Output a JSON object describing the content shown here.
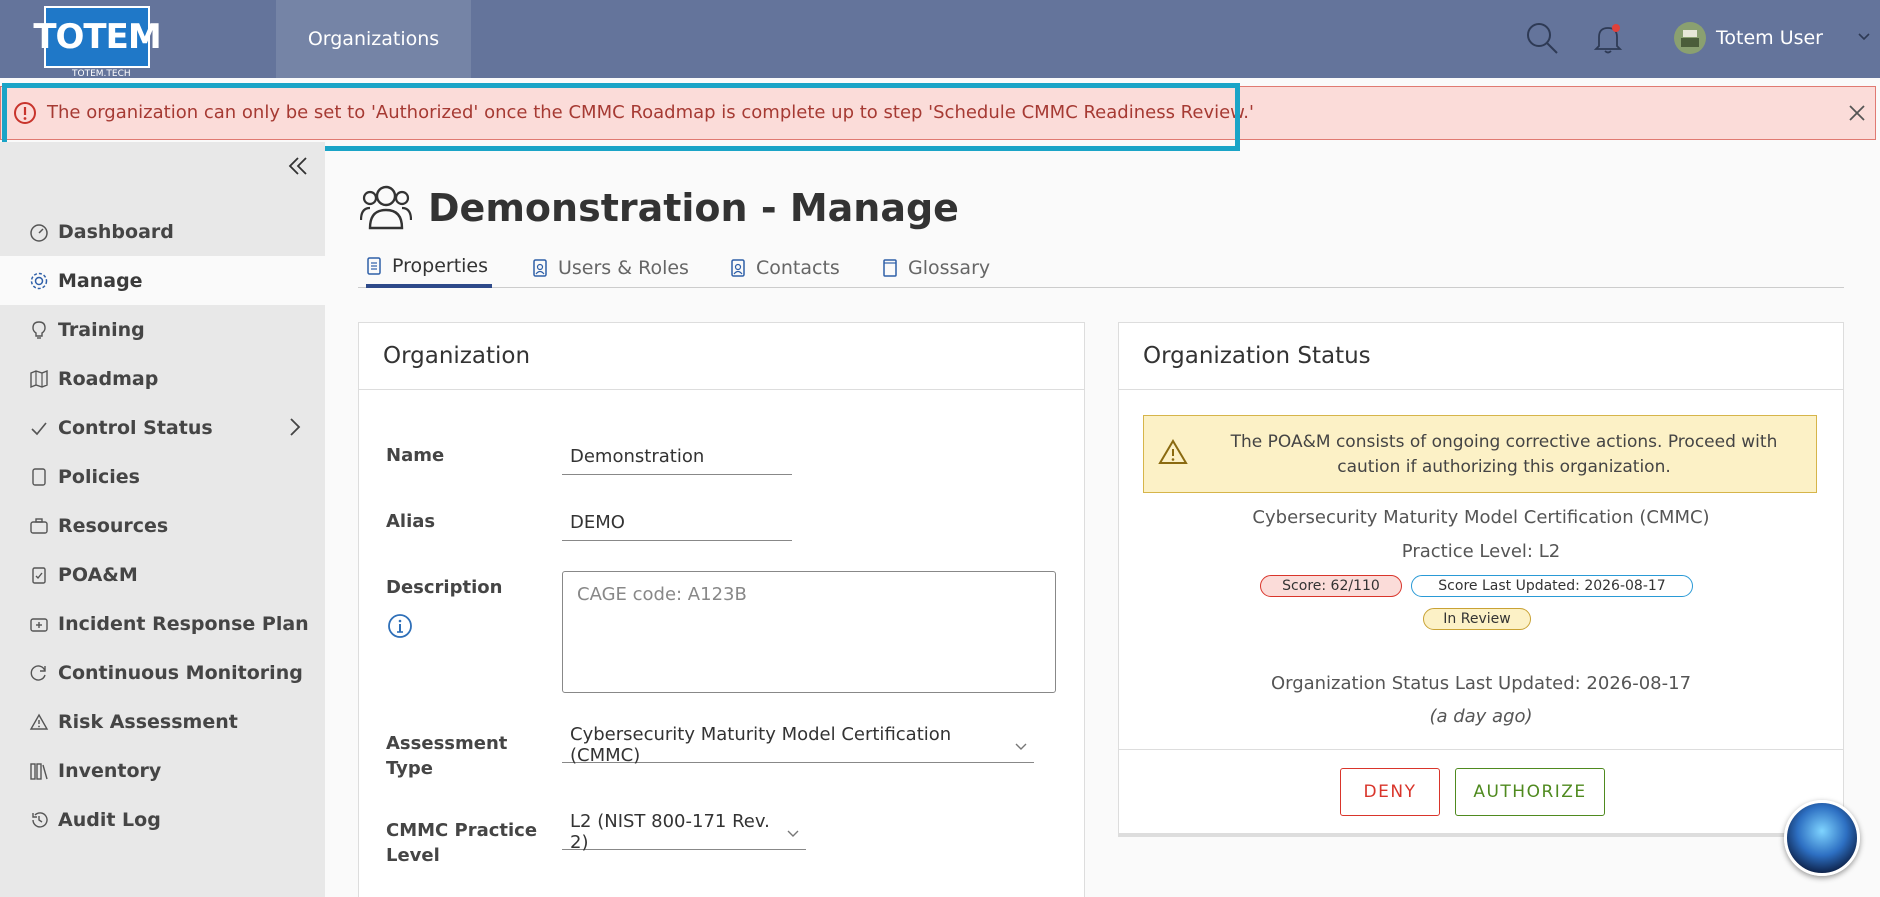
{
  "header": {
    "logo_text": "TOTEM",
    "logo_sub": "TOTEM.TECH",
    "nav_tab": "Organizations",
    "user_name": "Totem User",
    "icons": [
      "search-icon",
      "bell-icon",
      "avatar",
      "chevron-down-icon"
    ],
    "bg_color": "#64749b"
  },
  "alert": {
    "message": "The organization can only be set to 'Authorized' once the CMMC Roadmap is complete up to step 'Schedule CMMC Readiness Review.'",
    "icon": "error-icon",
    "close_icon": "close-icon"
  },
  "sidebar": {
    "items": [
      {
        "label": "Dashboard",
        "icon": "dashboard-icon"
      },
      {
        "label": "Manage",
        "icon": "gear-icon",
        "active": true
      },
      {
        "label": "Training",
        "icon": "lightbulb-icon"
      },
      {
        "label": "Roadmap",
        "icon": "map-icon"
      },
      {
        "label": "Control Status",
        "icon": "check-icon",
        "has_children": true
      },
      {
        "label": "Policies",
        "icon": "document-icon"
      },
      {
        "label": "Resources",
        "icon": "briefcase-icon"
      },
      {
        "label": "POA&M",
        "icon": "clipboard-icon"
      },
      {
        "label": "Incident Response Plan",
        "icon": "first-aid-icon"
      },
      {
        "label": "Continuous Monitoring",
        "icon": "refresh-icon"
      },
      {
        "label": "Risk Assessment",
        "icon": "warning-icon"
      },
      {
        "label": "Inventory",
        "icon": "inventory-icon"
      },
      {
        "label": "Audit Log",
        "icon": "history-icon"
      }
    ]
  },
  "page": {
    "title": "Demonstration - Manage",
    "icon": "users-icon",
    "tabs": [
      {
        "label": "Properties",
        "active": true
      },
      {
        "label": "Users & Roles"
      },
      {
        "label": "Contacts"
      },
      {
        "label": "Glossary"
      }
    ]
  },
  "organization": {
    "title": "Organization",
    "name_label": "Name",
    "name_value": "Demonstration",
    "alias_label": "Alias",
    "alias_value": "DEMO",
    "description_label": "Description",
    "description_placeholder": "CAGE code: A123B",
    "assessment_label_1": "Assessment",
    "assessment_label_2": "Type",
    "assessment_value": "Cybersecurity Maturity Model Certification (CMMC)",
    "practice_label_1": "CMMC Practice",
    "practice_label_2": "Level",
    "practice_value": "L2 (NIST 800-171 Rev. 2)"
  },
  "status": {
    "title": "Organization Status",
    "warning": "The POA&M consists of ongoing corrective actions. Proceed with caution if authorizing this organization.",
    "framework": "Cybersecurity Maturity Model Certification (CMMC)",
    "practice_level": "Practice Level: L2",
    "score_badge": "Score: 62/110",
    "score_updated_badge": "Score Last Updated: 2026-08-17",
    "review_badge": "In Review",
    "status_updated": "Organization Status Last Updated: 2026-08-17",
    "status_relative": "(a day ago)",
    "deny_label": "DENY",
    "authorize_label": "AUTHORIZE",
    "colors": {
      "deny": "#d9352b",
      "authorize": "#4f8a1f",
      "score_bg": "#fbdcd9",
      "updated_border": "#2a9ad6",
      "review_bg": "#fcf1c6"
    }
  }
}
